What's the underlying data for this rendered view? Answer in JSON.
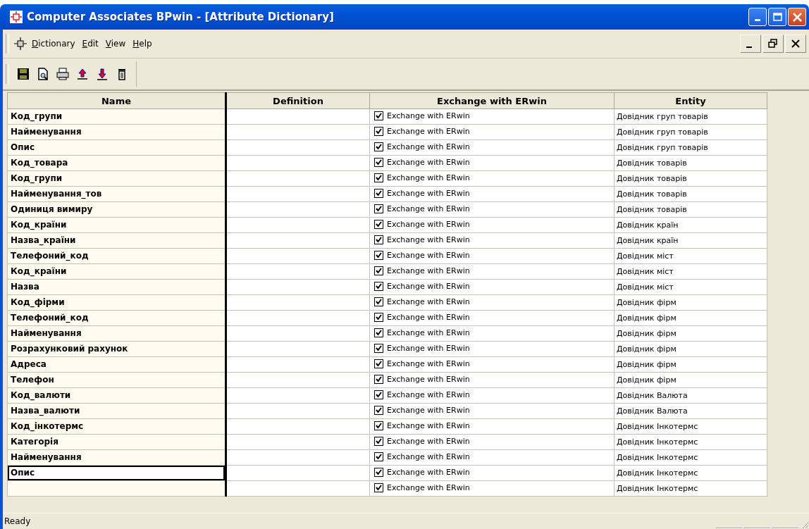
{
  "window": {
    "title": "Computer Associates BPwin - [Attribute Dictionary]"
  },
  "menu": [
    "Dictionary",
    "Edit",
    "View",
    "Help"
  ],
  "table": {
    "columns": [
      "Name",
      "Definition",
      "Exchange with ERwin",
      "Entity"
    ],
    "rows": [
      {
        "name": "Код_групи",
        "definition": "",
        "exchange": {
          "checked": true,
          "label": "Exchange with ERwin"
        },
        "entity": "Довідник груп товарів",
        "selected": false
      },
      {
        "name": "Найменування",
        "definition": "",
        "exchange": {
          "checked": true,
          "label": "Exchange with ERwin"
        },
        "entity": "Довідник груп товарів",
        "selected": false
      },
      {
        "name": "Опис",
        "definition": "",
        "exchange": {
          "checked": true,
          "label": "Exchange with ERwin"
        },
        "entity": "Довідник груп товарів",
        "selected": false
      },
      {
        "name": "Код_товара",
        "definition": "",
        "exchange": {
          "checked": true,
          "label": "Exchange with ERwin"
        },
        "entity": "Довідник товарів",
        "selected": false
      },
      {
        "name": "Код_групи",
        "definition": "",
        "exchange": {
          "checked": true,
          "label": "Exchange with ERwin"
        },
        "entity": "Довідник товарів",
        "selected": false
      },
      {
        "name": "Найменування_тов",
        "definition": "",
        "exchange": {
          "checked": true,
          "label": "Exchange with ERwin"
        },
        "entity": "Довідник товарів",
        "selected": false
      },
      {
        "name": "Одиниця вимиру",
        "definition": "",
        "exchange": {
          "checked": true,
          "label": "Exchange with ERwin"
        },
        "entity": "Довідник товарів",
        "selected": false
      },
      {
        "name": "Код_країни",
        "definition": "",
        "exchange": {
          "checked": true,
          "label": "Exchange with ERwin"
        },
        "entity": "Довідник країн",
        "selected": false
      },
      {
        "name": "Назва_країни",
        "definition": "",
        "exchange": {
          "checked": true,
          "label": "Exchange with ERwin"
        },
        "entity": "Довідник країн",
        "selected": false
      },
      {
        "name": "Телефоний_код",
        "definition": "",
        "exchange": {
          "checked": true,
          "label": "Exchange with ERwin"
        },
        "entity": "Довідник міст",
        "selected": false
      },
      {
        "name": "Код_країни",
        "definition": "",
        "exchange": {
          "checked": true,
          "label": "Exchange with ERwin"
        },
        "entity": "Довідник міст",
        "selected": false
      },
      {
        "name": "Назва",
        "definition": "",
        "exchange": {
          "checked": true,
          "label": "Exchange with ERwin"
        },
        "entity": "Довідник міст",
        "selected": false
      },
      {
        "name": "Код_фірми",
        "definition": "",
        "exchange": {
          "checked": true,
          "label": "Exchange with ERwin"
        },
        "entity": "Довідник фірм",
        "selected": false
      },
      {
        "name": "Телефоний_код",
        "definition": "",
        "exchange": {
          "checked": true,
          "label": "Exchange with ERwin"
        },
        "entity": "Довідник фірм",
        "selected": false
      },
      {
        "name": "Найменування",
        "definition": "",
        "exchange": {
          "checked": true,
          "label": "Exchange with ERwin"
        },
        "entity": "Довідник фірм",
        "selected": false
      },
      {
        "name": "Розрахунковий рахунок",
        "definition": "",
        "exchange": {
          "checked": true,
          "label": "Exchange with ERwin"
        },
        "entity": "Довідник фірм",
        "selected": false
      },
      {
        "name": "Адреса",
        "definition": "",
        "exchange": {
          "checked": true,
          "label": "Exchange with ERwin"
        },
        "entity": "Довідник фірм",
        "selected": false
      },
      {
        "name": "Телефон",
        "definition": "",
        "exchange": {
          "checked": true,
          "label": "Exchange with ERwin"
        },
        "entity": "Довідник фірм",
        "selected": false
      },
      {
        "name": "Код_валюти",
        "definition": "",
        "exchange": {
          "checked": true,
          "label": "Exchange with ERwin"
        },
        "entity": "Довідник Валюта",
        "selected": false
      },
      {
        "name": "Назва_валюти",
        "definition": "",
        "exchange": {
          "checked": true,
          "label": "Exchange with ERwin"
        },
        "entity": "Довідник Валюта",
        "selected": false
      },
      {
        "name": "Код_інкотермс",
        "definition": "",
        "exchange": {
          "checked": true,
          "label": "Exchange with ERwin"
        },
        "entity": "Довідник Інкотермс",
        "selected": false
      },
      {
        "name": "Категорія",
        "definition": "",
        "exchange": {
          "checked": true,
          "label": "Exchange with ERwin"
        },
        "entity": "Довідник Інкотермс",
        "selected": false
      },
      {
        "name": "Найменування",
        "definition": "",
        "exchange": {
          "checked": true,
          "label": "Exchange with ERwin"
        },
        "entity": "Довідник Інкотермс",
        "selected": false
      },
      {
        "name": "Опис",
        "definition": "",
        "exchange": {
          "checked": true,
          "label": "Exchange with ERwin"
        },
        "entity": "Довідник Інкотермс",
        "selected": true
      },
      {
        "name": "",
        "definition": "",
        "exchange": {
          "checked": true,
          "label": "Exchange with ERwin"
        },
        "entity": "Довідник Інкотермс",
        "selected": false
      }
    ]
  },
  "status_bar": {
    "text": "Ready"
  }
}
